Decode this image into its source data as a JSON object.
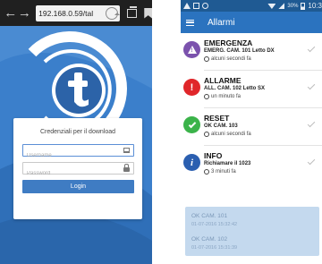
{
  "browser": {
    "url": "192.168.0.59/tal",
    "back_label": "←",
    "forward_label": "→",
    "icons": [
      "refresh-icon",
      "tabs-icon",
      "bookmark-icon"
    ]
  },
  "login": {
    "title": "Credenziali per il download",
    "username_placeholder": "Username",
    "password_placeholder": "Password",
    "button_label": "Login",
    "accent_color": "#3f7cc3"
  },
  "status_bar": {
    "battery_pct": "30%",
    "time": "10:3",
    "color": "#1f5a93"
  },
  "app_bar": {
    "title": "Allarmi",
    "color": "#2b73bf"
  },
  "alarms": [
    {
      "icon": "warning-icon",
      "color": "#7b52ad",
      "title": "EMERGENZA",
      "detail": "EMERG. CAM. 101 Letto DX",
      "time": "alcuni secondi fa"
    },
    {
      "icon": "exclamation-icon",
      "color": "#e0262a",
      "title": "ALLARME",
      "detail": "ALL. CAM. 102 Letto SX",
      "time": "un minuto fa"
    },
    {
      "icon": "check-icon",
      "color": "#3bb34a",
      "title": "RESET",
      "detail": "OK CAM. 103",
      "time": "alcuni secondi fa"
    },
    {
      "icon": "info-icon",
      "color": "#2b5fb0",
      "title": "INFO",
      "detail": "Richiamare il 1023",
      "time": "3 minuti fa"
    }
  ],
  "history": [
    {
      "label": "OK CAM. 101",
      "date": "01-07-2016 15:32:42"
    },
    {
      "label": "OK CAM. 102",
      "date": "01-07-2016 15:31:39"
    }
  ]
}
